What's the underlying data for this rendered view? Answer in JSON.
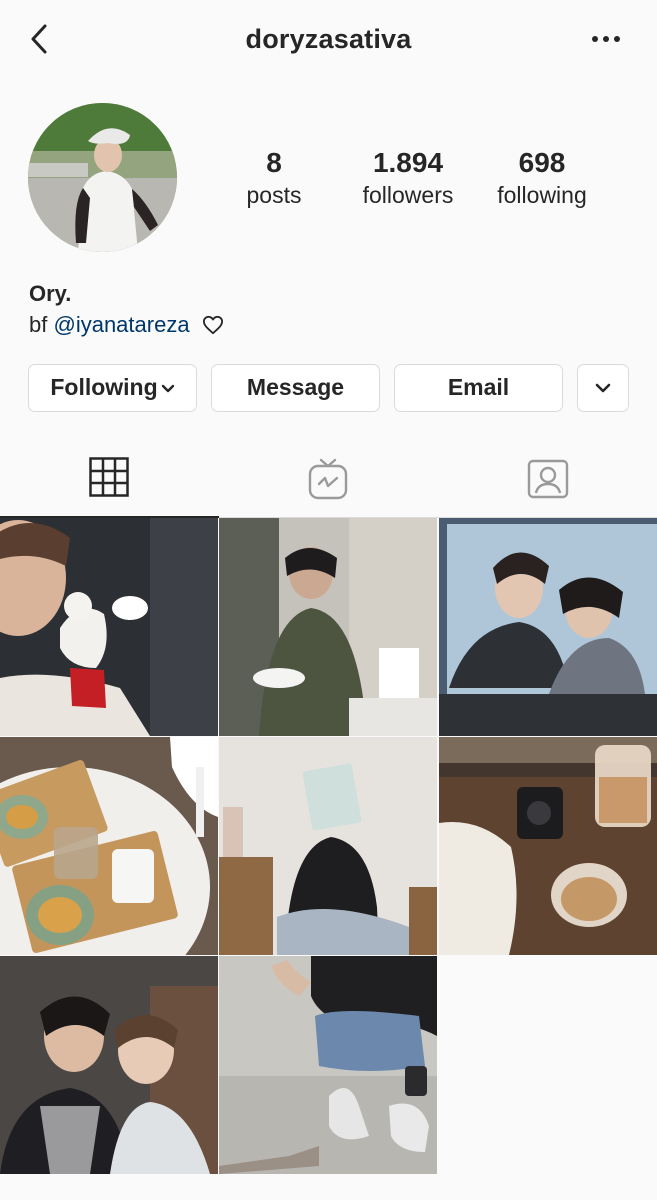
{
  "header": {
    "username": "doryzasativa"
  },
  "profile": {
    "posts_count": "8",
    "posts_label": "posts",
    "followers_count": "1.894",
    "followers_label": "followers",
    "following_count": "698",
    "following_label": "following",
    "display_name": "Ory.",
    "bio_prefix": "bf",
    "bio_mention": "@iyanatareza"
  },
  "actions": {
    "following": "Following",
    "message": "Message",
    "email": "Email"
  },
  "tabs": [
    "grid-icon",
    "igtv-icon",
    "tagged-icon"
  ],
  "colors": {
    "mention": "#00376b",
    "text": "#262626",
    "border": "#dbdbdb",
    "background": "#fafafa"
  }
}
